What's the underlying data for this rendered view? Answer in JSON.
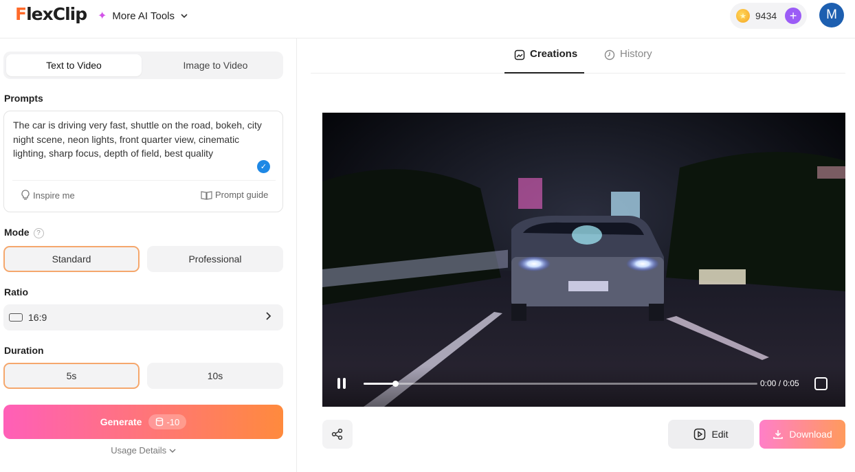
{
  "header": {
    "logo_text": "FlexClip",
    "ai_tools_label": "More AI Tools",
    "credits": "9434",
    "avatar_letter": "M"
  },
  "left": {
    "tabs": [
      {
        "label": "Text to Video",
        "active": true
      },
      {
        "label": "Image to Video",
        "active": false
      }
    ],
    "prompts_label": "Prompts",
    "prompt_text": "The car is driving very fast, shuttle on the road, bokeh, city night scene, neon lights, front quarter view, cinematic lighting, sharp focus, depth of field, best quality",
    "inspire_label": "Inspire me",
    "guide_label": "Prompt guide",
    "mode_label": "Mode",
    "mode_help": "?",
    "modes": [
      {
        "label": "Standard",
        "selected": true
      },
      {
        "label": "Professional",
        "selected": false
      }
    ],
    "ratio_label": "Ratio",
    "ratio_value": "16:9",
    "duration_label": "Duration",
    "durations": [
      {
        "label": "5s",
        "selected": true
      },
      {
        "label": "10s",
        "selected": false
      }
    ],
    "generate_label": "Generate",
    "generate_cost": "-10",
    "usage_label": "Usage Details"
  },
  "right": {
    "tabs": [
      {
        "label": "Creations",
        "active": true
      },
      {
        "label": "History",
        "active": false
      }
    ],
    "player": {
      "time": "0:00 / 0:05",
      "progress": 0.08
    },
    "edit_label": "Edit",
    "download_label": "Download"
  },
  "colors": {
    "accent_orange": "#ff8a3d",
    "accent_pink": "#ff5fb8",
    "selected_border": "#f5a76c",
    "check_blue": "#1e88e5",
    "avatar_blue": "#1d5fb0",
    "plus_purple": "#9b5cf6"
  }
}
